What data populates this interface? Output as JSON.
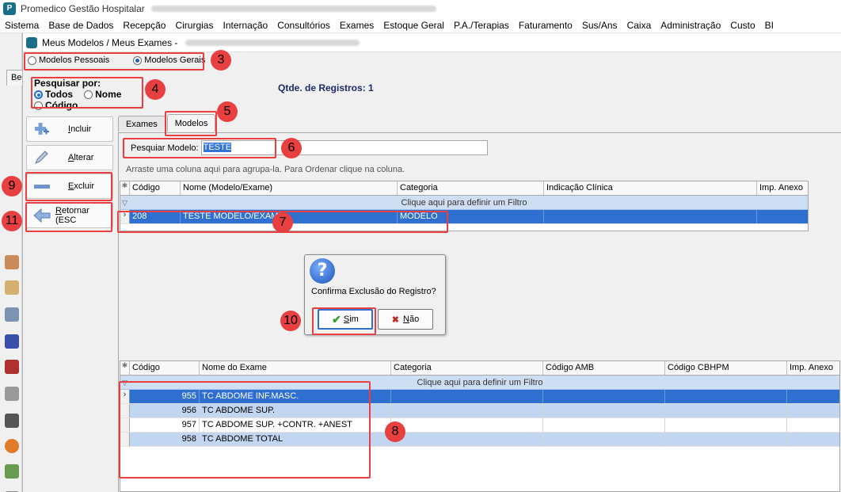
{
  "app": {
    "logo": "P",
    "title": "Promedico Gestão Hospitalar"
  },
  "menu": [
    "Sistema",
    "Base de Dados",
    "Recepção",
    "Cirurgias",
    "Internação",
    "Consultórios",
    "Exames",
    "Estoque Geral",
    "P.A./Terapias",
    "Faturamento",
    "Sus/Ans",
    "Caixa",
    "Administração",
    "Custo",
    "BI"
  ],
  "background": {
    "tab_label": "Be"
  },
  "dialog": {
    "title": "Meus Modelos / Meus Exames -",
    "model_type": {
      "personal": "Modelos Pessoais",
      "general": "Modelos Gerais",
      "selected": "general"
    },
    "search_by": {
      "label": "Pesquisar por:",
      "all": "Todos",
      "name": "Nome",
      "code": "Código",
      "selected": "all"
    },
    "record_count": {
      "label": "Qtde. de Registros:",
      "value": "1"
    },
    "buttons": {
      "include": {
        "u": "I",
        "rest": "ncluir"
      },
      "edit": {
        "u": "A",
        "rest": "lterar"
      },
      "delete": {
        "u": "E",
        "rest": "xcluir"
      },
      "back": {
        "u": "R",
        "rest": "etornar (ESC"
      }
    },
    "tabs": [
      "Exames",
      "Modelos"
    ],
    "search_model": {
      "label": "Pesquiar Modelo:",
      "value": "TESTE"
    },
    "group_hint": "Arraste uma coluna aqui para agrupa-la. Para Ordenar clique na coluna.",
    "filter_hint": "Clique aqui para definir um Filtro",
    "models_grid": {
      "columns": [
        "Código",
        "Nome (Modelo/Exame)",
        "Categoria",
        "Indicação Clínica",
        "Imp. Anexo"
      ],
      "rows": [
        {
          "code": "208",
          "name": "TESTE MODELO/EXAME",
          "category": "MODELO",
          "indication": "",
          "attach": ""
        }
      ]
    },
    "exams_grid": {
      "columns": [
        "Código",
        "Nome do Exame",
        "Categoria",
        "Código AMB",
        "Código CBHPM",
        "Imp. Anexo"
      ],
      "rows": [
        {
          "code": "955",
          "name": "TC ABDOME INF.MASC."
        },
        {
          "code": "956",
          "name": "TC ABDOME SUP."
        },
        {
          "code": "957",
          "name": "TC ABDOME SUP. +CONTR. +ANEST"
        },
        {
          "code": "958",
          "name": "TC ABDOME TOTAL"
        }
      ]
    }
  },
  "confirm": {
    "icon": "question-icon",
    "message": "Confirma Exclusão do Registro?",
    "yes": {
      "u": "S",
      "rest": "im"
    },
    "no": {
      "u": "N",
      "rest": "ão"
    }
  },
  "annotations": [
    "3",
    "4",
    "5",
    "6",
    "7",
    "8",
    "9",
    "10",
    "11"
  ],
  "colors": {
    "annotation": "#e84040",
    "selection": "#2f6fcf",
    "alt_row": "#c3d6f1"
  }
}
